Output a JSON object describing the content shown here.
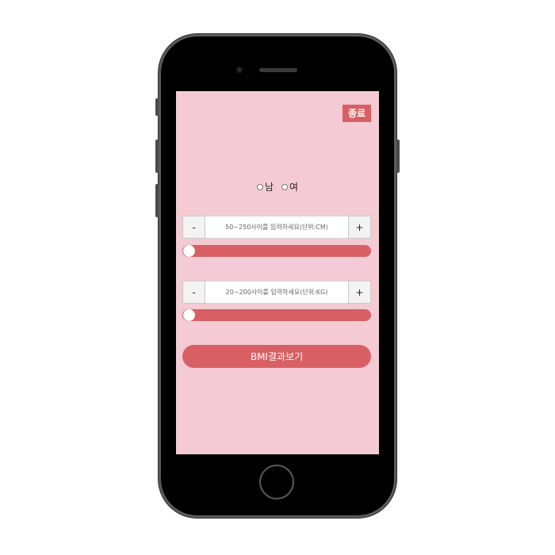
{
  "header": {
    "exit_label": "종료"
  },
  "gender": {
    "options": [
      {
        "label": "남",
        "selected": false
      },
      {
        "label": "여",
        "selected": false
      }
    ]
  },
  "height": {
    "minus_label": "-",
    "plus_label": "+",
    "placeholder": "50~250사이를 입력하세요(단위:CM)",
    "slider_level": 0
  },
  "weight": {
    "minus_label": "-",
    "plus_label": "+",
    "placeholder": "20~200사이를 입력하세요(단위:KG)",
    "slider_level": 0
  },
  "result": {
    "button_label": "BMI결과보기"
  },
  "colors": {
    "screen_bg": "#f4cbd4",
    "accent": "#d86064"
  }
}
